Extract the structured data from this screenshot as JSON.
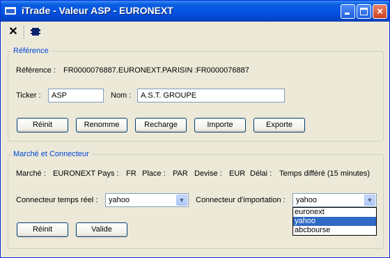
{
  "window": {
    "title": "iTrade - Valeur ASP - EURONEXT"
  },
  "toolbar": {
    "close_glyph": "✕"
  },
  "reference": {
    "legend": "Référence",
    "ref_label": "Référence :",
    "ref_value": "FR0000076887.EURONEXT.PAR",
    "isin_label": "ISIN :",
    "isin_value": "FR0000076887",
    "ticker_label": "Ticker :",
    "ticker_value": "ASP",
    "name_label": "Nom :",
    "name_value": "A.S.T. GROUPE",
    "buttons": {
      "reinit": "Réinit",
      "renomme": "Renomme",
      "recharge": "Recharge",
      "importe": "Importe",
      "exporte": "Exporte"
    }
  },
  "market": {
    "legend": "Marché et Connecteur",
    "marche_label": "Marché :",
    "marche_value": "EURONEXT",
    "pays_label": "Pays :",
    "pays_value": "FR",
    "place_label": "Place :",
    "place_value": "PAR",
    "devise_label": "Devise :",
    "devise_value": "EUR",
    "delai_label": "Délai :",
    "delai_value": "Temps différé (15 minutes)",
    "rt_label": "Connecteur temps réel :",
    "rt_value": "yahoo",
    "imp_label": "Connecteur d'importation :",
    "imp_value": "yahoo",
    "imp_options": [
      "euronext",
      "yahoo",
      "abcbourse"
    ],
    "imp_selected_index": 1,
    "buttons": {
      "reinit": "Réinit",
      "valide": "Valide"
    }
  }
}
